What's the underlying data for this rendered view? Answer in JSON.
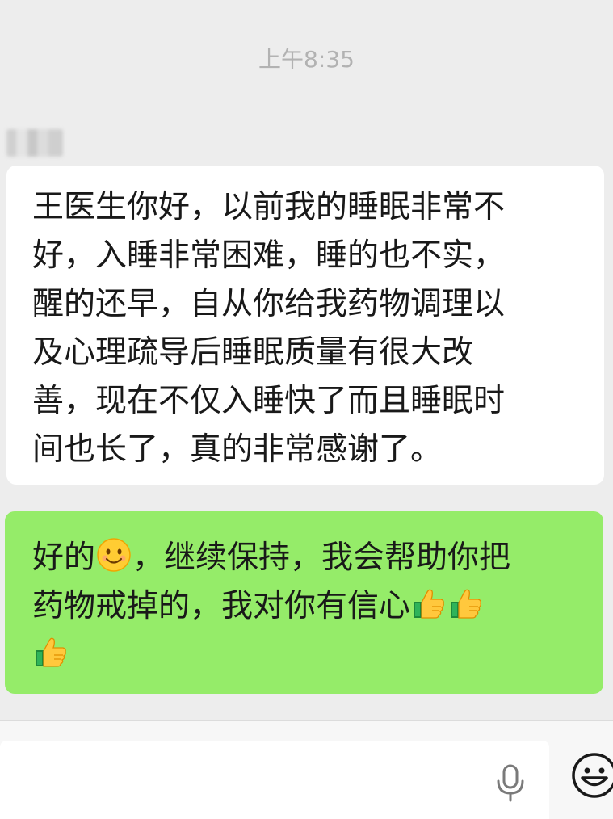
{
  "chat": {
    "timestamp": "上午8:35",
    "sender_name_blurred": "",
    "incoming": {
      "lines": [
        "王医生你好，以前我的睡眠非常不",
        "好，入睡非常困难，睡的也不实，",
        "醒的还早，自从你给我药物调理以",
        "及心理疏导后睡眠质量有很大改",
        "善，现在不仅入睡快了而且睡眠时",
        "间也长了，真的非常感谢了。"
      ]
    },
    "outgoing": {
      "line1_a": "好的",
      "line1_b": "，继续保持，我会帮助你把",
      "line2": "药物戒掉的，我对你有信心",
      "emojis": [
        "smile-emoji",
        "thumbs-up-emoji",
        "thumbs-up-emoji",
        "thumbs-up-emoji"
      ]
    }
  },
  "input_bar": {
    "icons": [
      "microphone-icon",
      "emoji-smile-icon"
    ]
  },
  "colors": {
    "background": "#ededed",
    "incoming_bubble": "#ffffff",
    "outgoing_bubble": "#95ec69",
    "timestamp": "#b2b2b2"
  }
}
